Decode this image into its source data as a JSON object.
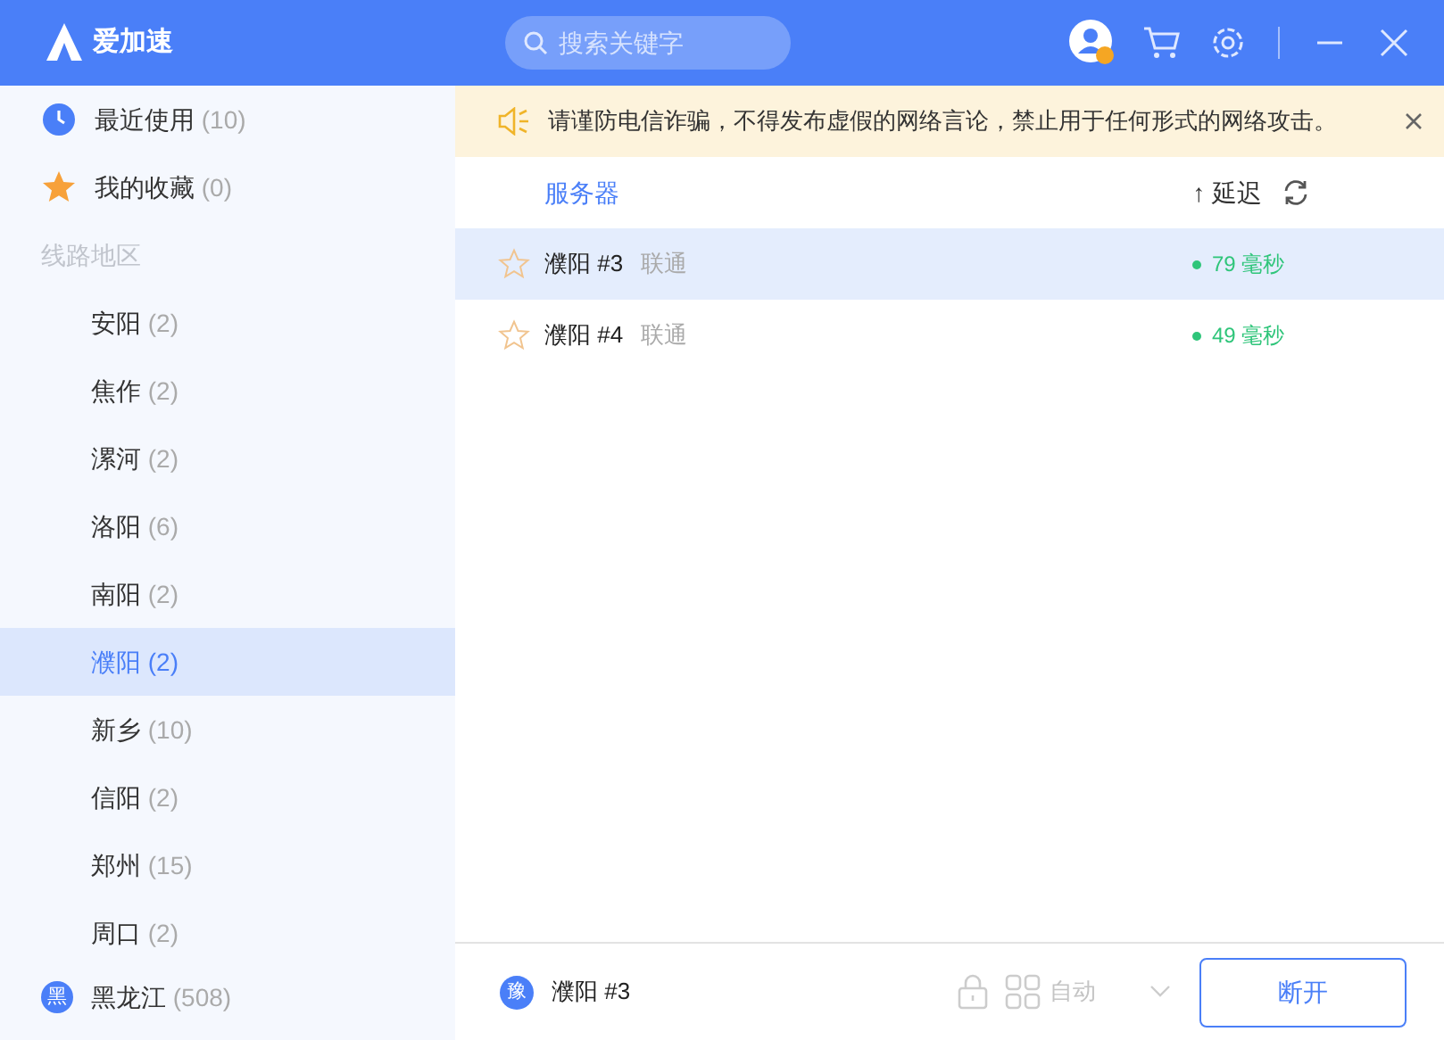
{
  "app": {
    "name": "爱加速"
  },
  "search": {
    "placeholder": "搜索关键字"
  },
  "sidebar": {
    "top_items": [
      {
        "kind": "recent",
        "label": "最近使用",
        "count": "(10)",
        "selected": false
      },
      {
        "kind": "favorites",
        "label": "我的收藏",
        "count": "(0)",
        "selected": false
      }
    ],
    "section_title": "线路地区",
    "regions": [
      {
        "label": "安阳",
        "count": "(2)",
        "selected": false
      },
      {
        "label": "焦作",
        "count": "(2)",
        "selected": false
      },
      {
        "label": "漯河",
        "count": "(2)",
        "selected": false
      },
      {
        "label": "洛阳",
        "count": "(6)",
        "selected": false
      },
      {
        "label": "南阳",
        "count": "(2)",
        "selected": false
      },
      {
        "label": "濮阳",
        "count": "(2)",
        "selected": true
      },
      {
        "label": "新乡",
        "count": "(10)",
        "selected": false
      },
      {
        "label": "信阳",
        "count": "(2)",
        "selected": false
      },
      {
        "label": "郑州",
        "count": "(15)",
        "selected": false
      },
      {
        "label": "周口",
        "count": "(2)",
        "selected": false
      }
    ],
    "provinces": [
      {
        "badge": "黑",
        "label": "黑龙江",
        "count": "(508)"
      }
    ]
  },
  "notice": {
    "text": "请谨防电信诈骗，不得发布虚假的网络言论，禁止用于任何形式的网络攻击。"
  },
  "table": {
    "columns": [
      "服务器",
      "↑ 延迟"
    ],
    "rows": [
      {
        "name": "濮阳 #3",
        "carrier": "联通",
        "latency": "79 毫秒",
        "starred": false,
        "selected": true
      },
      {
        "name": "濮阳 #4",
        "carrier": "联通",
        "latency": "49 毫秒",
        "starred": false,
        "selected": false
      }
    ]
  },
  "footer": {
    "badge": "豫",
    "server": "濮阳 #3",
    "mode": "自动",
    "button": "断开"
  }
}
